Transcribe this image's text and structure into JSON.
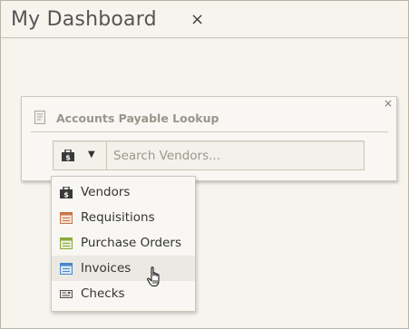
{
  "dashboard": {
    "title": "My Dashboard",
    "close_glyph": "×"
  },
  "widget": {
    "title": "Accounts Payable Lookup",
    "close_glyph": "×",
    "icon": "document-icon"
  },
  "search": {
    "selected_category_icon": "money-bag-icon",
    "caret_glyph": "▼",
    "placeholder": "Search Vendors...",
    "value": ""
  },
  "menu": {
    "items": [
      {
        "label": "Vendors",
        "icon": "money-bag-icon",
        "color": "#3c3c3c"
      },
      {
        "label": "Requisitions",
        "icon": "requisitions-icon",
        "color": "#c8764a"
      },
      {
        "label": "Purchase Orders",
        "icon": "purchase-orders-icon",
        "color": "#8caa3c"
      },
      {
        "label": "Invoices",
        "icon": "invoices-icon",
        "color": "#4a86c8"
      },
      {
        "label": "Checks",
        "icon": "checks-icon",
        "color": "#555555"
      }
    ],
    "hovered_index": 3
  }
}
